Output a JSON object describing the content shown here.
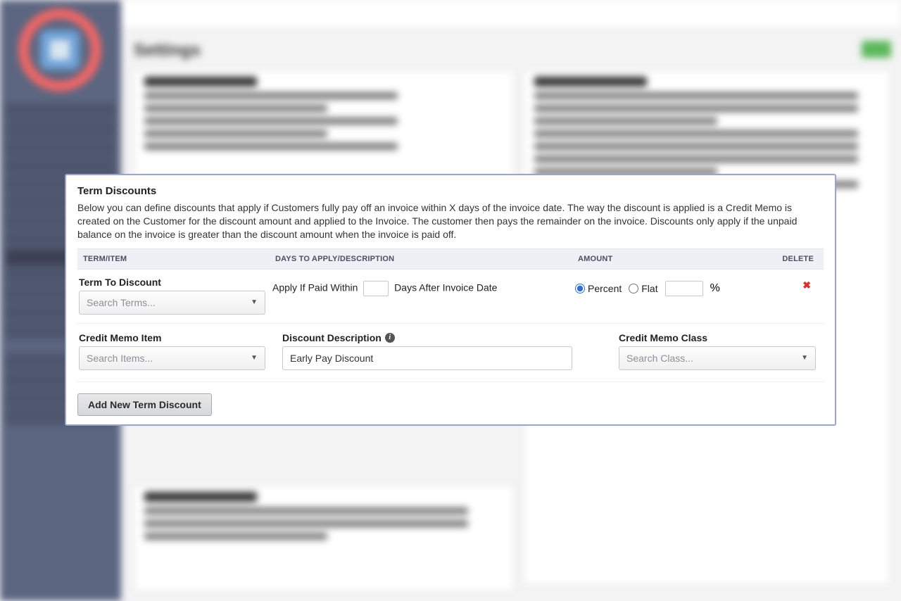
{
  "page": {
    "title": "Settings"
  },
  "panel": {
    "title": "Term Discounts",
    "description": "Below you can define discounts that apply if Customers fully pay off an invoice within X days of the invoice date. The way the discount is applied is a Credit Memo is created on the Customer for the discount amount and applied to the Invoice. The customer then pays the remainder on the invoice. Discounts only apply if the unpaid balance on the invoice is greater than the discount amount when the invoice is paid off.",
    "columns": {
      "term": "TERM/ITEM",
      "days": "DAYS TO APPLY/DESCRIPTION",
      "amount": "AMOUNT",
      "delete": "DELETE"
    },
    "row": {
      "term_label": "Term To Discount",
      "term_placeholder": "Search Terms...",
      "apply_prefix": "Apply If Paid Within",
      "apply_suffix": "Days After Invoice Date",
      "days_value": "",
      "amount_type": "percent",
      "percent_label": "Percent",
      "flat_label": "Flat",
      "amount_value": "",
      "amount_unit": "%",
      "credit_item_label": "Credit Memo Item",
      "credit_item_placeholder": "Search Items...",
      "desc_label": "Discount Description",
      "desc_value": "Early Pay Discount",
      "class_label": "Credit Memo Class",
      "class_placeholder": "Search Class..."
    },
    "add_button": "Add New Term Discount"
  }
}
